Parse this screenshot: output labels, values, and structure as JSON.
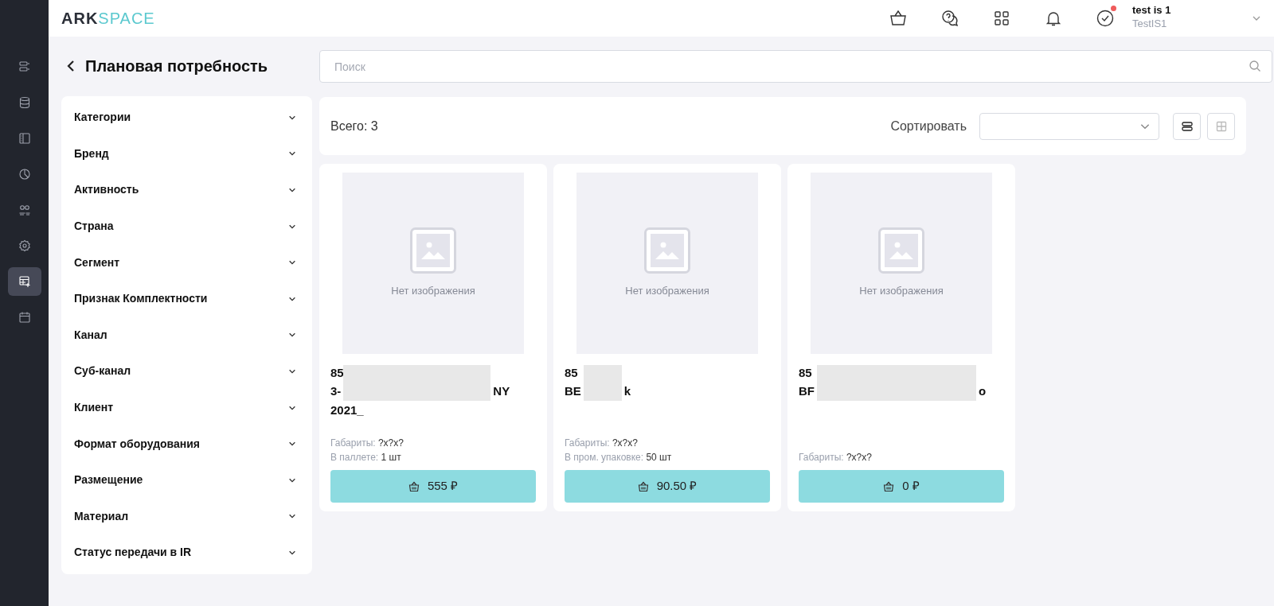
{
  "logo": {
    "dark": "ARK",
    "light": "SPACE"
  },
  "header": {
    "notification_dot": true,
    "user": {
      "name": "test is 1",
      "login": "TestIS1"
    }
  },
  "sidebar": {
    "items": [
      {
        "selected": false
      },
      {
        "selected": false
      },
      {
        "selected": false
      },
      {
        "selected": false
      },
      {
        "selected": false
      },
      {
        "selected": false
      },
      {
        "selected": true
      },
      {
        "selected": false
      }
    ]
  },
  "page": {
    "title": "Плановая потребность",
    "search": {
      "placeholder": "Поиск"
    }
  },
  "filters": [
    {
      "label": "Категории"
    },
    {
      "label": "Бренд"
    },
    {
      "label": "Активность"
    },
    {
      "label": "Страна"
    },
    {
      "label": "Сегмент"
    },
    {
      "label": "Признак Комплектности"
    },
    {
      "label": "Канал"
    },
    {
      "label": "Суб-канал"
    },
    {
      "label": "Клиент"
    },
    {
      "label": "Формат оборудования"
    },
    {
      "label": "Размещение"
    },
    {
      "label": "Материал"
    },
    {
      "label": "Статус передачи в IR"
    }
  ],
  "toolbar": {
    "total": "Всего: 3",
    "sort_label": "Сортировать",
    "view_buttons": [
      {
        "selected": true
      },
      {
        "selected": false
      }
    ]
  },
  "products": [
    {
      "image_text": "Нет изображения",
      "title_lines": [
        [
          "85"
        ],
        [
          "3-",
          "NY"
        ],
        [
          "2021_"
        ]
      ],
      "details": [
        {
          "label": "Габариты:",
          "value": "?x?x?"
        },
        {
          "label": "В паллете:",
          "value": "1 шт"
        }
      ],
      "price": "555 ₽"
    },
    {
      "image_text": "Нет изображения",
      "title_lines": [
        [
          "85"
        ],
        [
          "BE",
          "k"
        ]
      ],
      "details": [
        {
          "label": "Габариты:",
          "value": "?x?x?"
        },
        {
          "label": "В пром. упаковке:",
          "value": "50 шт"
        }
      ],
      "price": "90.50 ₽"
    },
    {
      "image_text": "Нет изображения",
      "title_lines": [
        [
          "85"
        ],
        [
          "BF",
          "o"
        ]
      ],
      "details": [
        {
          "label": "Габариты:",
          "value": "?x?x?"
        }
      ],
      "price": "0 ₽"
    }
  ]
}
